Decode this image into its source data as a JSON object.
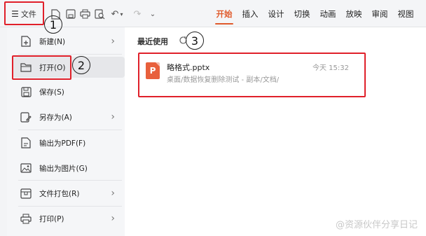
{
  "toolbar": {
    "file_label": "文件",
    "tabs": [
      "开始",
      "插入",
      "设计",
      "切换",
      "动画",
      "放映",
      "审阅",
      "视图"
    ]
  },
  "sidebar": {
    "items": [
      {
        "label": "新建(N)",
        "icon": "new-icon",
        "arrow": true
      },
      {
        "label": "打开(O)",
        "icon": "folder-icon",
        "arrow": false
      },
      {
        "label": "保存(S)",
        "icon": "save-icon",
        "arrow": false
      },
      {
        "label": "另存为(A)",
        "icon": "save-as-icon",
        "arrow": true
      },
      {
        "label": "输出为PDF(F)",
        "icon": "pdf-icon",
        "arrow": false
      },
      {
        "label": "输出为图片(G)",
        "icon": "image-icon",
        "arrow": false
      },
      {
        "label": "文件打包(R)",
        "icon": "package-icon",
        "arrow": true
      },
      {
        "label": "打印(P)",
        "icon": "print-icon",
        "arrow": true
      }
    ]
  },
  "recent": {
    "title": "最近使用",
    "file": {
      "name": "略格式.pptx",
      "path": "桌面/数据恢复删除测试 - 副本/文档/",
      "time": "今天 15:32",
      "icon_letter": "P"
    }
  },
  "annotations": {
    "n1": "1",
    "n2": "2",
    "n3": "3"
  },
  "watermark": "@资源伙伴分享日记",
  "colors": {
    "accent": "#e05a2b",
    "annotation_red": "#e0202a",
    "ppt_orange": "#e8603c"
  }
}
